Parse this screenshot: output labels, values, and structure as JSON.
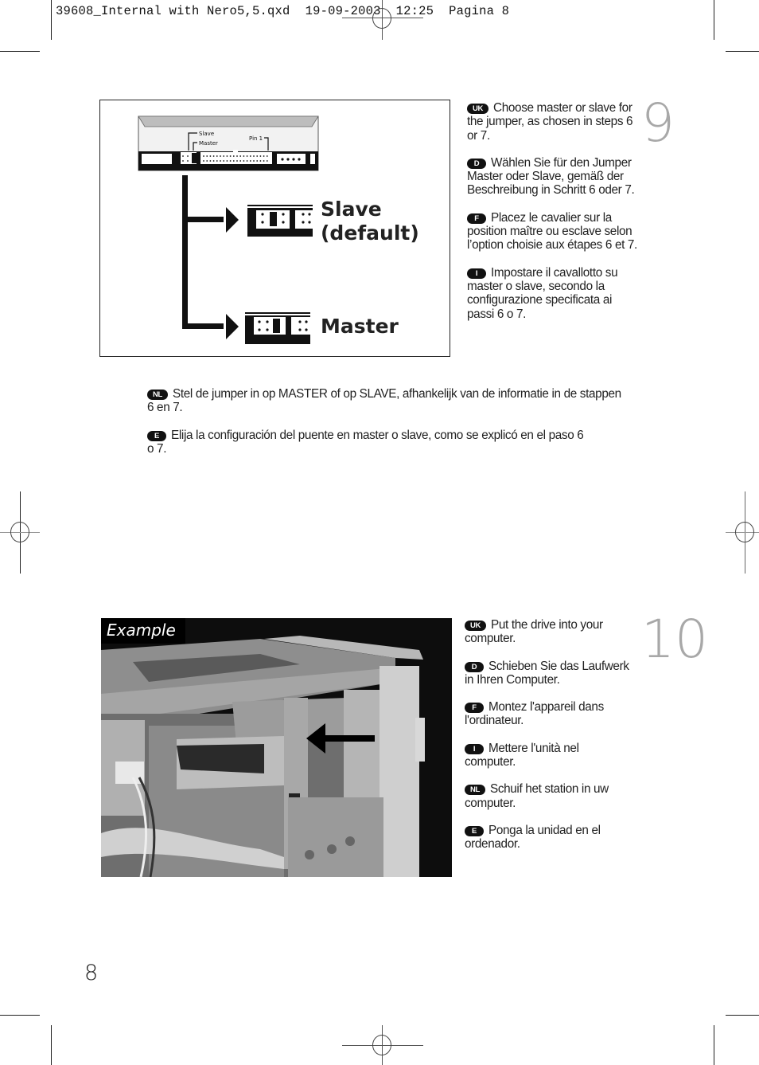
{
  "slug": {
    "filename": "39608_Internal with Nero5,5.qxd",
    "date": "19-09-2003",
    "time": "12:25",
    "page_label": "Pagina 8"
  },
  "step9": {
    "number": "9",
    "diagram": {
      "slave_label": "Slave",
      "master_label": "Master",
      "pin1_label": "Pin 1",
      "option_slave": "Slave",
      "option_slave_default": "(default)",
      "option_master": "Master"
    },
    "instructions": [
      {
        "lang": "UK",
        "text": "Choose master or slave for the jumper, as chosen in steps 6 or 7."
      },
      {
        "lang": "D",
        "text": "Wählen Sie für den Jumper Master oder Slave, gemäß der Beschreibung in Schritt 6 oder 7."
      },
      {
        "lang": "F",
        "text": "Placez le cavalier sur la position maître ou esclave selon l’option choisie aux étapes 6 et 7."
      },
      {
        "lang": "I",
        "text": "Impostare il cavallotto su master o slave, secondo la configurazione specificata ai passi 6 o 7."
      }
    ],
    "instructions_wide": [
      {
        "lang": "NL",
        "text": "Stel de jumper in op MASTER of op SLAVE, afhankelijk van de informatie in de stappen 6 en 7."
      },
      {
        "lang": "E",
        "text": "Elija la configuración del puente en master o slave, como se explicó en el paso 6 o 7."
      }
    ]
  },
  "step10": {
    "number": "10",
    "photo_label": "Example",
    "instructions": [
      {
        "lang": "UK",
        "text": "Put the drive into your computer."
      },
      {
        "lang": "D",
        "text": "Schieben Sie das Laufwerk in Ihren Computer."
      },
      {
        "lang": "F",
        "text": "Montez l'appareil dans l'ordinateur."
      },
      {
        "lang": "I",
        "text": "Mettere l'unità nel computer."
      },
      {
        "lang": "NL",
        "text": "Schuif het station in uw computer."
      },
      {
        "lang": "E",
        "text": "Ponga la unidad en el ordenador."
      }
    ]
  },
  "footer": {
    "page_number": "8"
  }
}
